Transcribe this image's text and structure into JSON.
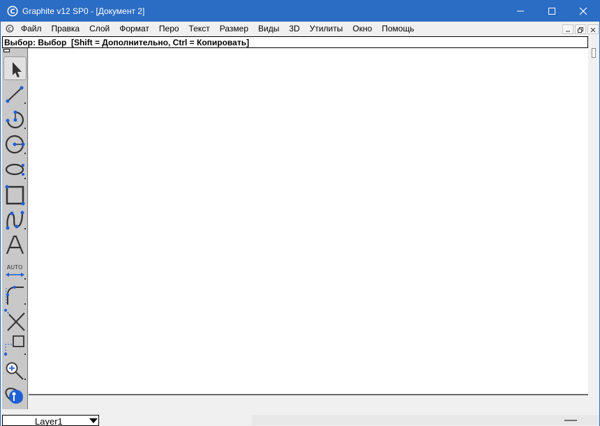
{
  "window": {
    "title": "Graphite v12 SP0 - [Документ 2]"
  },
  "menu": {
    "items": [
      "Файл",
      "Правка",
      "Слой",
      "Формат",
      "Перо",
      "Текст",
      "Размер",
      "Виды",
      "3D",
      "Утилиты",
      "Окно",
      "Помощь"
    ]
  },
  "prompt": {
    "text": "Выбор: Выбор  [Shift = Дополнительно, Ctrl = Копировать]"
  },
  "toolbox": {
    "tools": [
      {
        "icon": "select-arrow-icon",
        "selected": true
      },
      {
        "icon": "line-icon",
        "selected": false
      },
      {
        "icon": "arc-icon",
        "selected": false
      },
      {
        "icon": "circle-icon",
        "selected": false
      },
      {
        "icon": "ellipse-icon",
        "selected": false
      },
      {
        "icon": "rectangle-icon",
        "selected": false
      },
      {
        "icon": "curve-icon",
        "selected": false
      },
      {
        "icon": "text-icon",
        "selected": false
      },
      {
        "icon": "dimension-icon",
        "selected": false
      },
      {
        "icon": "fillet-icon",
        "selected": false
      },
      {
        "icon": "trim-icon",
        "selected": false
      },
      {
        "icon": "offset-icon",
        "selected": false
      },
      {
        "icon": "zoom-icon",
        "selected": false
      },
      {
        "icon": "render-globe-icon",
        "selected": false
      }
    ],
    "dimension_label": "AUTO"
  },
  "status": {
    "layer": "Layer1"
  },
  "colors": {
    "titlebar": "#2b6cc4",
    "accent_point": "#1f5fd6",
    "tool_stroke": "#333333"
  }
}
